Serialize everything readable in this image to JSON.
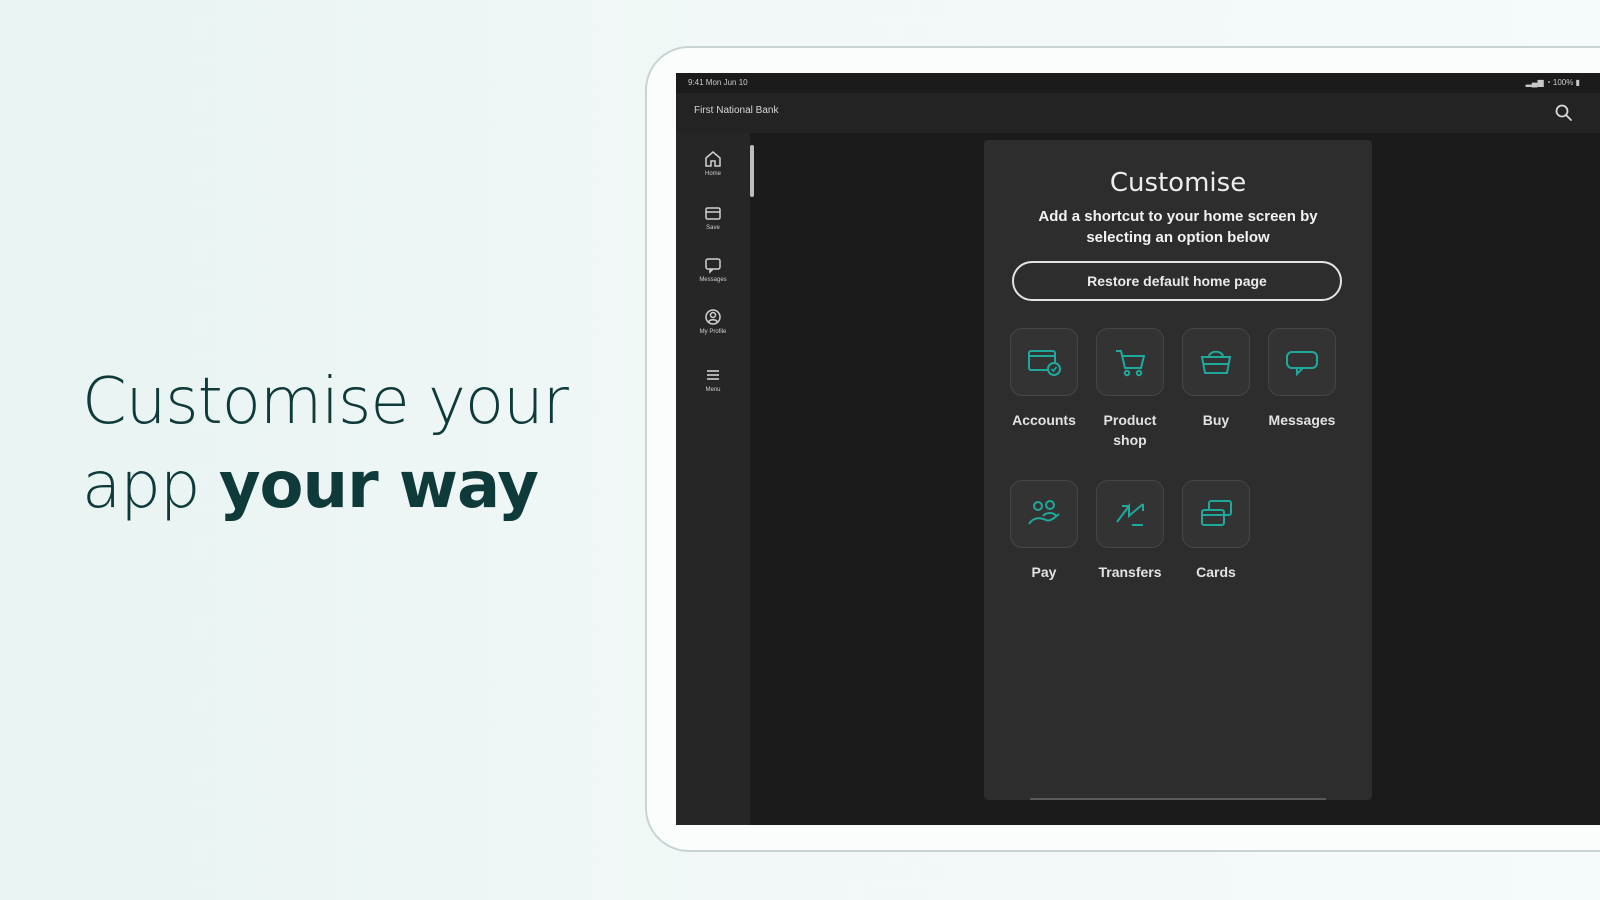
{
  "hero": {
    "line1": "Customise your",
    "line2_plain": "app ",
    "line2_bold": "your way"
  },
  "statusbar": {
    "left": "9:41  Mon Jun 10",
    "right": "▂▄▆ ◔ 100% ▮"
  },
  "appbar": {
    "bank_name": "First National Bank"
  },
  "rail": {
    "items": [
      {
        "label": "Home",
        "icon": "home-icon"
      },
      {
        "label": "Save",
        "icon": "wallet-icon"
      },
      {
        "label": "Messages",
        "icon": "message-icon"
      },
      {
        "label": "My Profile",
        "icon": "profile-icon"
      },
      {
        "label": "Menu",
        "icon": "menu-icon"
      }
    ]
  },
  "panel": {
    "title": "Customise",
    "subtitle": "Add a shortcut to your home screen by selecting an option below",
    "restore_label": "Restore default home page",
    "shortcuts": [
      {
        "label": "Accounts",
        "icon": "accounts-icon"
      },
      {
        "label": "Product shop",
        "icon": "cart-icon"
      },
      {
        "label": "Buy",
        "icon": "basket-icon"
      },
      {
        "label": "Messages",
        "icon": "chat-icon"
      },
      {
        "label": "Pay",
        "icon": "pay-icon"
      },
      {
        "label": "Transfers",
        "icon": "transfer-icon"
      },
      {
        "label": "Cards",
        "icon": "cards-icon"
      }
    ]
  },
  "colors": {
    "accent": "#1fa89c",
    "hero_text": "#0f3a3a",
    "screen_bg": "#1b1b1b",
    "panel_bg": "#2d2d2d"
  }
}
